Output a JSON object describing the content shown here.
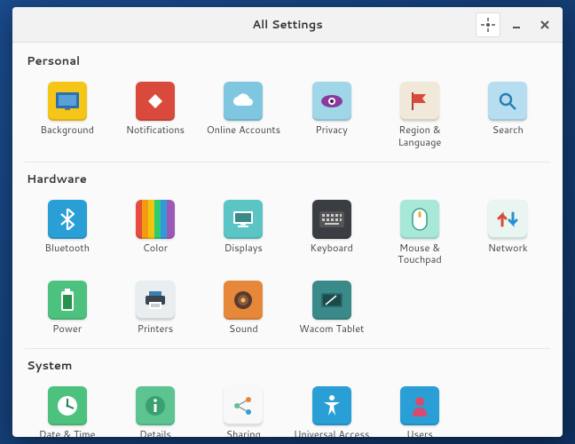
{
  "window": {
    "title": "All Settings"
  },
  "sections": {
    "personal": {
      "title": "Personal",
      "items": [
        {
          "label": "Background"
        },
        {
          "label": "Notifications"
        },
        {
          "label": "Online Accounts"
        },
        {
          "label": "Privacy"
        },
        {
          "label": "Region & Language"
        },
        {
          "label": "Search"
        }
      ]
    },
    "hardware": {
      "title": "Hardware",
      "items": [
        {
          "label": "Bluetooth"
        },
        {
          "label": "Color"
        },
        {
          "label": "Displays"
        },
        {
          "label": "Keyboard"
        },
        {
          "label": "Mouse & Touchpad"
        },
        {
          "label": "Network"
        },
        {
          "label": "Power"
        },
        {
          "label": "Printers"
        },
        {
          "label": "Sound"
        },
        {
          "label": "Wacom Tablet"
        }
      ]
    },
    "system": {
      "title": "System",
      "items": [
        {
          "label": "Date & Time"
        },
        {
          "label": "Details"
        },
        {
          "label": "Sharing"
        },
        {
          "label": "Universal Access"
        },
        {
          "label": "Users"
        }
      ]
    }
  }
}
